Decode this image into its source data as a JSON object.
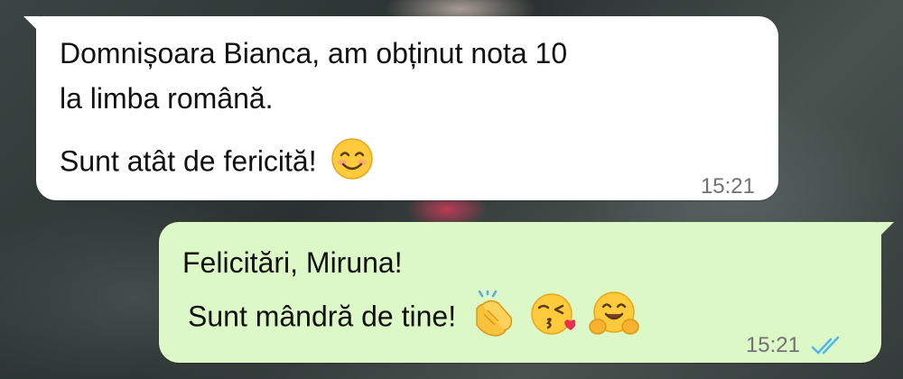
{
  "chat": {
    "incoming": {
      "line1": "Domnișoara Bianca, am obținut nota 10",
      "line2": "la limba română.",
      "line3": "Sunt atât de fericită!",
      "time": "15:21",
      "emojis": [
        "smiling-face-icon"
      ]
    },
    "outgoing": {
      "line1": "Felicitări, Miruna!",
      "line2": "Sunt mândră de tine!",
      "time": "15:21",
      "emojis": [
        "clapping-hands-icon",
        "kissing-face-icon",
        "hugging-face-icon"
      ],
      "status": "read-double-check-icon"
    }
  },
  "colors": {
    "incoming_bubble": "#ffffff",
    "outgoing_bubble": "#dcf8c6",
    "read_check": "#4fb6ec",
    "timestamp": "#727272"
  }
}
